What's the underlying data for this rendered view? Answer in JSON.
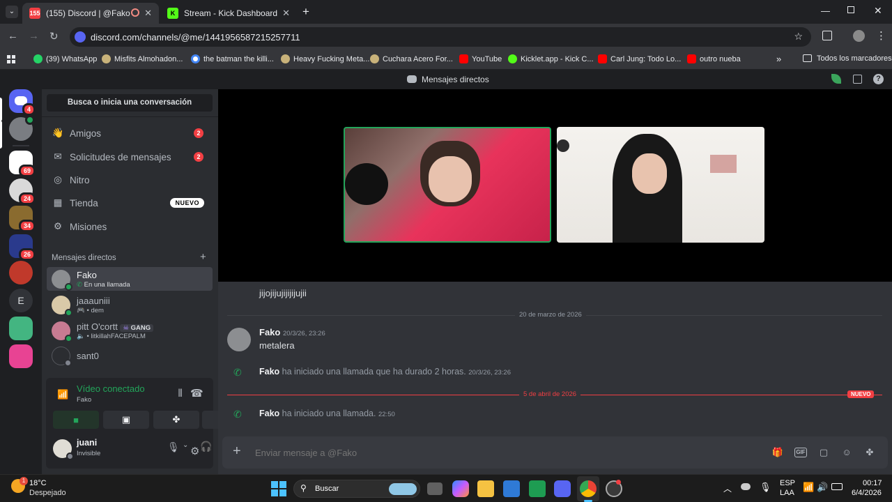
{
  "browser": {
    "tabs": [
      {
        "label": "(155) Discord | @Fako",
        "badge": "155",
        "active": true
      },
      {
        "label": "Stream - Kick Dashboard",
        "active": false
      }
    ],
    "url": "discord.com/channels/@me/1441956587215257711",
    "bookmarks": [
      {
        "label": "(39) WhatsApp",
        "icon": "whatsapp-icon",
        "color": "#25d366"
      },
      {
        "label": "Misfits Almohadon...",
        "icon": "site-icon",
        "color": "#c8b27a"
      },
      {
        "label": "the batman the killi...",
        "icon": "google-icon",
        "color": "#4285f4"
      },
      {
        "label": "Heavy Fucking Meta...",
        "icon": "site-icon",
        "color": "#c8b27a"
      },
      {
        "label": "Cuchara Acero For...",
        "icon": "site-icon",
        "color": "#c8b27a"
      },
      {
        "label": "YouTube",
        "icon": "youtube-icon",
        "color": "#ff0000"
      },
      {
        "label": "Kicklet.app - Kick C...",
        "icon": "kicklet-icon",
        "color": "#53fc18"
      },
      {
        "label": "Carl Jung: Todo Lo...",
        "icon": "youtube-icon",
        "color": "#ff0000"
      },
      {
        "label": "outro nueba",
        "icon": "youtube-icon",
        "color": "#ff0000"
      }
    ],
    "all_bookmarks": "Todos los marcadores"
  },
  "discord": {
    "title": "Mensajes directos",
    "home_badge": "4",
    "guilds": [
      {
        "letter": "",
        "badge": "",
        "color": "#7a7d82"
      },
      {
        "letter": "",
        "badge": "69",
        "color": "#ffffff"
      },
      {
        "letter": "",
        "badge": "24",
        "color": "#d9d9d9"
      },
      {
        "letter": "",
        "badge": "34",
        "color": "#8a6b2f"
      },
      {
        "letter": "",
        "badge": "26",
        "color": "#2a3a8c"
      },
      {
        "letter": "",
        "badge": "",
        "color": "#c0392b"
      },
      {
        "letter": "E",
        "badge": "",
        "color": "#313338"
      },
      {
        "letter": "",
        "badge": "",
        "color": "#43b581"
      },
      {
        "letter": "",
        "badge": "",
        "color": "#e84393"
      }
    ],
    "search_label": "Busca o inicia una conversación",
    "nav": [
      {
        "label": "Amigos",
        "badge": "2"
      },
      {
        "label": "Solicitudes de mensajes",
        "badge": "2"
      },
      {
        "label": "Nitro",
        "badge": ""
      },
      {
        "label": "Tienda",
        "badge": "NUEVO"
      },
      {
        "label": "Misiones",
        "badge": ""
      }
    ],
    "dm_header": "Mensajes directos",
    "dms": [
      {
        "name": "Fako",
        "sub": "En una llamada",
        "tag": ""
      },
      {
        "name": "jaaauniii",
        "sub": "• dem",
        "tag": ""
      },
      {
        "name": "pitt O'cortt",
        "sub": "• litkillahFACEPALM",
        "tag": "GANG"
      },
      {
        "name": "sant0",
        "sub": "",
        "tag": ""
      }
    ],
    "voice": {
      "status": "Vídeo conectado",
      "channel": "Fako"
    },
    "user": {
      "name": "juani",
      "status": "Invisible"
    },
    "messages": {
      "prev_line": "jijojijujijijijujii",
      "date1": "20 de marzo de 2026",
      "author": "Fako",
      "author_ts": "20/3/26, 23:26",
      "text": "metalera",
      "call1_name": "Fako",
      "call1_text": "ha iniciado una llamada que ha durado 2 horas.",
      "call1_ts": "20/3/26, 23:26",
      "date2": "5 de abril de 2026",
      "new_label": "NUEVO",
      "call2_name": "Fako",
      "call2_text": "ha iniciado una llamada.",
      "call2_ts": "22:50"
    },
    "composer_placeholder": "Enviar mensaje a @Fako"
  },
  "taskbar": {
    "weather_temp": "18°C",
    "weather_desc": "Despejado",
    "weather_badge": "1",
    "search": "Buscar",
    "lang1": "ESP",
    "lang2": "LAA",
    "time": "00:17",
    "date": "6/4/2026"
  }
}
